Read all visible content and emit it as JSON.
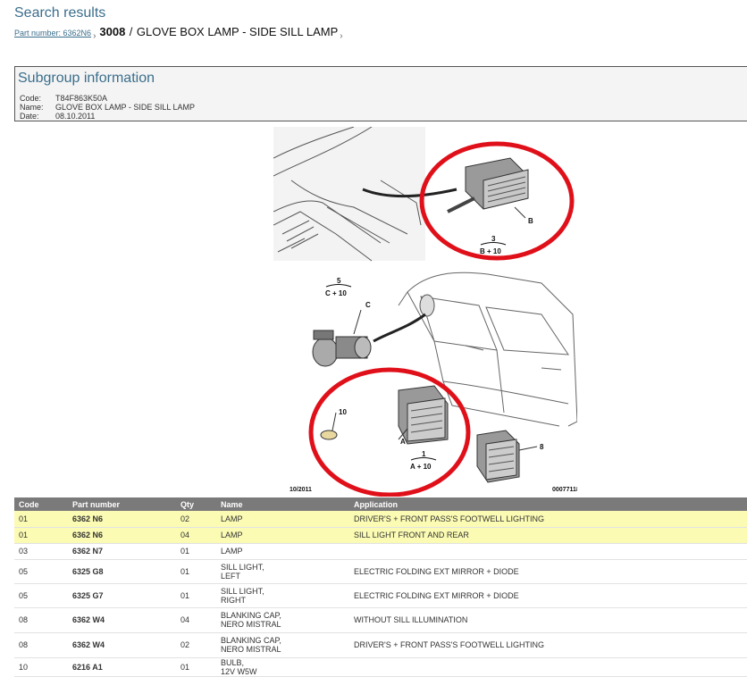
{
  "header": {
    "title": "Search results",
    "breadcrumb_link": "Part number: 6362N6",
    "breadcrumb_code": "3008",
    "breadcrumb_sep": "/",
    "breadcrumb_title": "GLOVE BOX LAMP - SIDE SILL LAMP"
  },
  "subgroup": {
    "heading": "Subgroup information",
    "code_label": "Code:",
    "code_value": "T84F863K50A",
    "name_label": "Name:",
    "name_value": "GLOVE BOX LAMP - SIDE SILL LAMP",
    "date_label": "Date:",
    "date_value": "08.10.2011"
  },
  "diagram": {
    "labels": {
      "b": "B",
      "c": "C",
      "a": "A",
      "ref3": "3",
      "ref3sub": "B + 10",
      "ref5": "5",
      "ref5sub": "C + 10",
      "ref1": "1",
      "ref1sub": "A + 10",
      "ref10": "10",
      "ref8": "8",
      "date": "10/2011",
      "id": "00077118"
    },
    "highlight_color": "#e0101a"
  },
  "table": {
    "headers": [
      "Code",
      "Part number",
      "Qty",
      "Name",
      "Application"
    ],
    "rows": [
      {
        "code": "01",
        "part": "6362 N6",
        "qty": "02",
        "name1": "LAMP",
        "name2": "",
        "app": "DRIVER'S + FRONT PASS'S FOOTWELL LIGHTING",
        "highlight": true
      },
      {
        "code": "01",
        "part": "6362 N6",
        "qty": "04",
        "name1": "LAMP",
        "name2": "",
        "app": "SILL LIGHT FRONT AND REAR",
        "highlight": true
      },
      {
        "code": "03",
        "part": "6362 N7",
        "qty": "01",
        "name1": "LAMP",
        "name2": "",
        "app": "",
        "highlight": false
      },
      {
        "code": "05",
        "part": "6325 G8",
        "qty": "01",
        "name1": "SILL LIGHT,",
        "name2": "LEFT",
        "app": "ELECTRIC FOLDING EXT MIRROR + DIODE",
        "highlight": false
      },
      {
        "code": "05",
        "part": "6325 G7",
        "qty": "01",
        "name1": "SILL LIGHT,",
        "name2": "RIGHT",
        "app": "ELECTRIC FOLDING EXT MIRROR + DIODE",
        "highlight": false
      },
      {
        "code": "08",
        "part": "6362 W4",
        "qty": "04",
        "name1": "BLANKING CAP,",
        "name2": "NERO MISTRAL",
        "app": "WITHOUT SILL ILLUMINATION",
        "highlight": false
      },
      {
        "code": "08",
        "part": "6362 W4",
        "qty": "02",
        "name1": "BLANKING CAP,",
        "name2": "NERO MISTRAL",
        "app": "DRIVER'S + FRONT PASS'S FOOTWELL LIGHTING",
        "highlight": false
      },
      {
        "code": "10",
        "part": "6216 A1",
        "qty": "01",
        "name1": "BULB,",
        "name2": "12V W5W",
        "app": "",
        "highlight": false
      }
    ]
  }
}
